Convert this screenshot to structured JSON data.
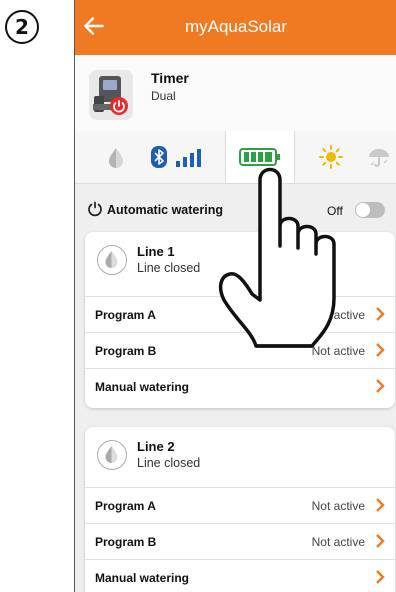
{
  "step_badge": "2",
  "app": {
    "title": "myAquaSolar"
  },
  "device": {
    "name": "Timer",
    "subtitle": "Dual"
  },
  "status_icons": [
    "drop-icon",
    "bluetooth-icon",
    "signal-icon",
    "battery-icon",
    "sun-icon",
    "rain-icon"
  ],
  "automatic_watering": {
    "label": "Automatic watering",
    "state": "Off"
  },
  "lines": [
    {
      "name": "Line 1",
      "status": "Line closed",
      "rows": [
        {
          "label": "Program A",
          "value": "Not active"
        },
        {
          "label": "Program B",
          "value": "Not active"
        },
        {
          "label": "Manual watering",
          "value": ""
        }
      ]
    },
    {
      "name": "Line 2",
      "status": "Line closed",
      "rows": [
        {
          "label": "Program A",
          "value": "Not active"
        },
        {
          "label": "Program B",
          "value": "Not active"
        },
        {
          "label": "Manual watering",
          "value": ""
        }
      ]
    }
  ],
  "colors": {
    "accent": "#f07a22",
    "bluetooth": "#1e5fb0",
    "battery": "#2ea044",
    "sun": "#f2b800"
  }
}
